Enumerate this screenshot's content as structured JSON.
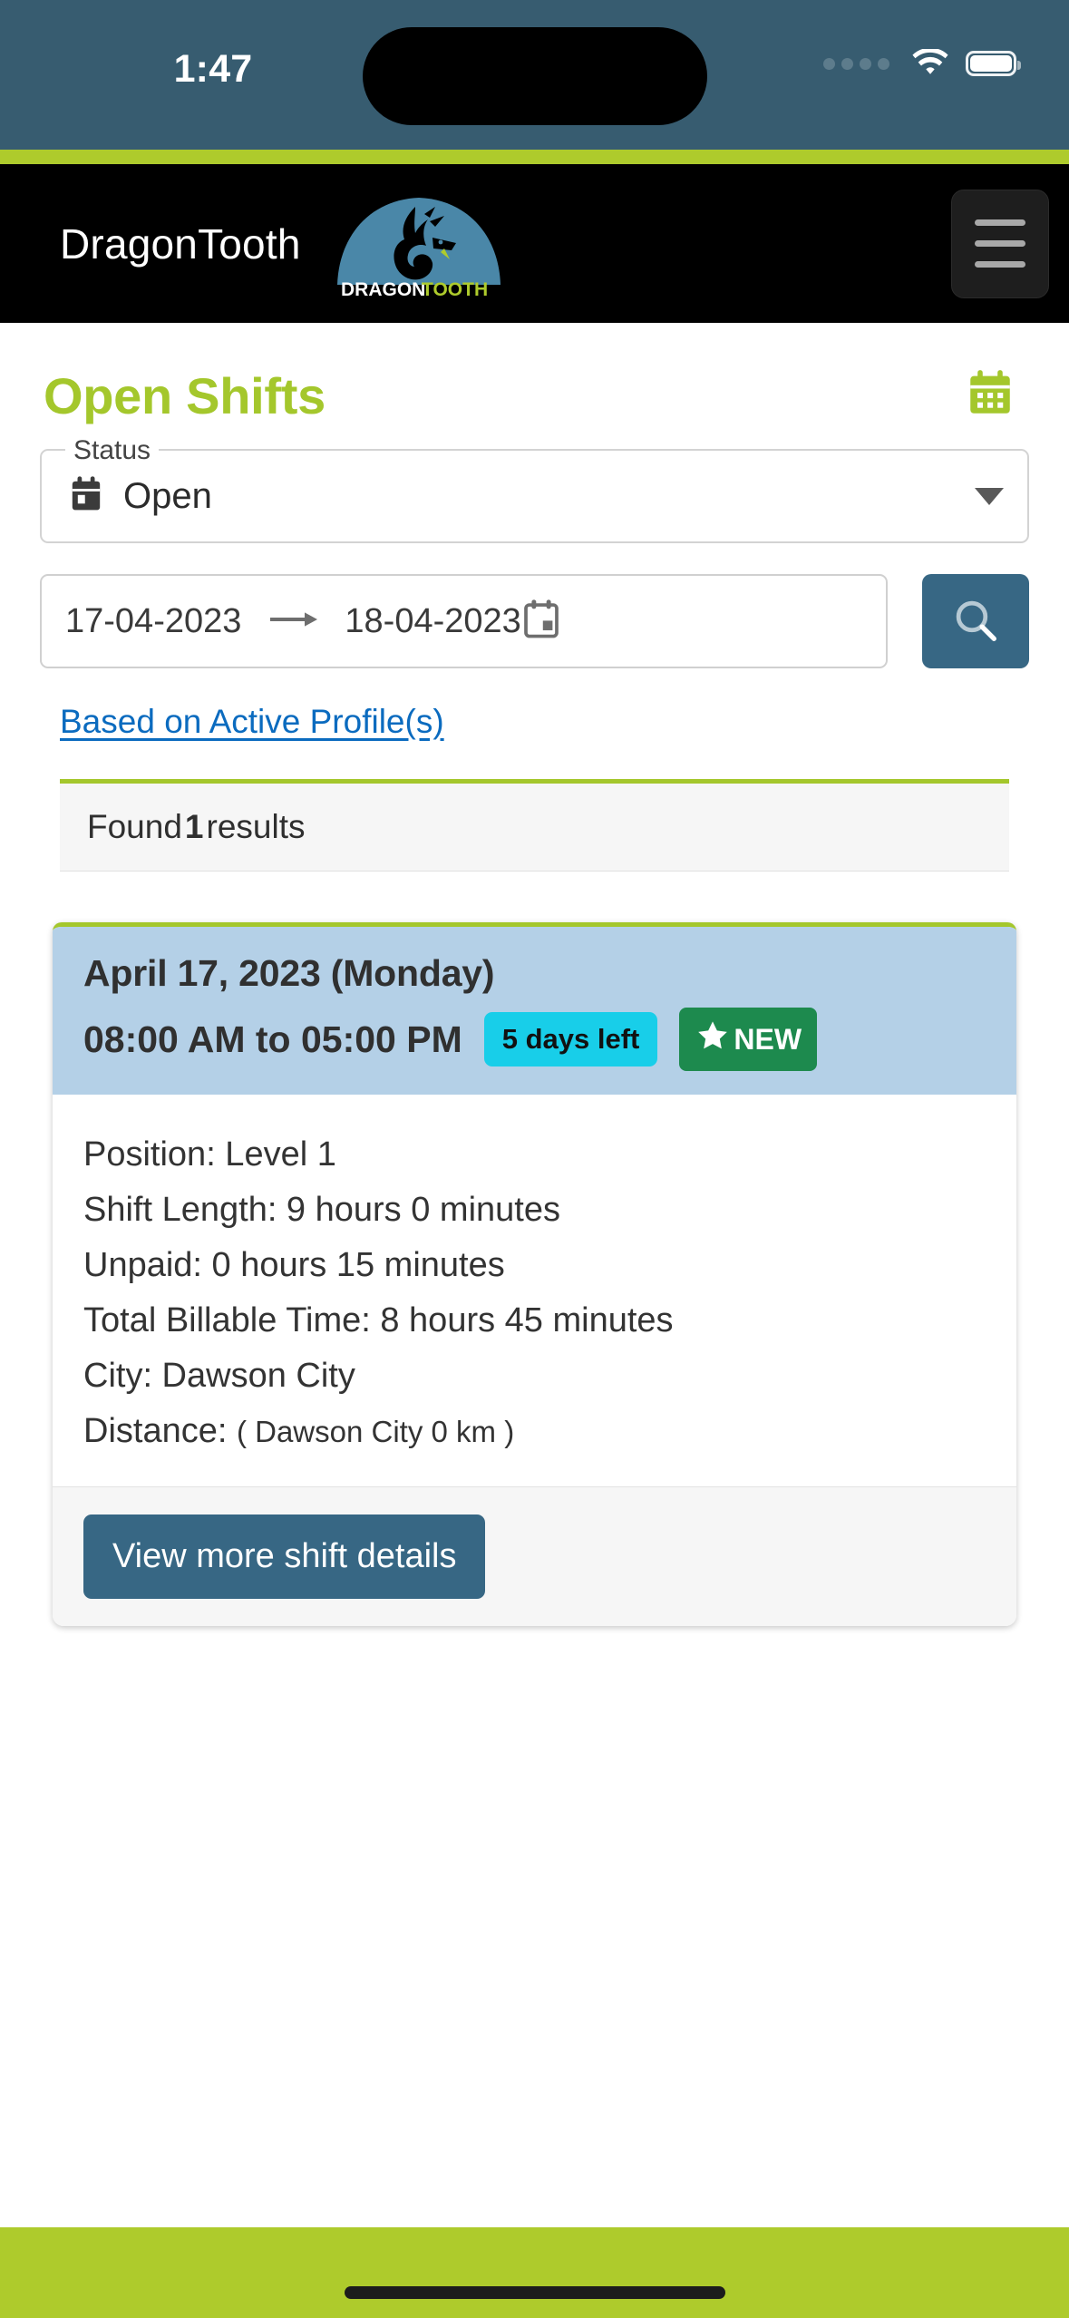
{
  "status_bar": {
    "time": "1:47",
    "signal_icon": "signal-dots-icon",
    "wifi_icon": "wifi-icon",
    "battery_icon": "battery-full-icon"
  },
  "appbar": {
    "brand_title": "DragonTooth",
    "logo_text_primary": "DRAGON",
    "logo_text_secondary": "TOOTH",
    "menu_icon": "hamburger-menu-icon"
  },
  "page": {
    "title": "Open Shifts",
    "calendar_icon": "calendar-icon"
  },
  "status_field": {
    "legend": "Status",
    "value": "Open",
    "icon": "event-calendar-icon",
    "caret_icon": "chevron-down-icon"
  },
  "date_range": {
    "start": "17-04-2023",
    "end": "18-04-2023",
    "arrow_icon": "arrow-right-icon",
    "picker_icon": "calendar-picker-icon"
  },
  "search_button": {
    "icon": "search-icon"
  },
  "profile_link": {
    "label": "Based on Active Profile(s)"
  },
  "results": {
    "prefix": "Found",
    "count": "1",
    "suffix": "results"
  },
  "shift_card": {
    "date": "April 17, 2023 (Monday)",
    "time": "08:00 AM to 05:00 PM",
    "badge_days_left": "5 days left",
    "badge_new": "NEW",
    "badge_new_icon": "star-icon",
    "details": [
      "Position: Level 1",
      "Shift Length: 9 hours 0 minutes",
      "Unpaid: 0 hours 15 minutes",
      "Total Billable Time: 8 hours 45 minutes",
      "City: Dawson City"
    ],
    "distance_label": "Distance:",
    "distance_value": "( Dawson City 0 km )",
    "action_label": "View more shift details"
  },
  "colors": {
    "brand_green": "#AECB2C",
    "title_green": "#A4C72C",
    "steel_blue": "#376784",
    "status_bar_blue": "#375C70",
    "card_header_blue": "#B4D0E7",
    "badge_cyan": "#18CEE9",
    "badge_green": "#1D8A4E",
    "link_blue": "#0B6BBF"
  }
}
